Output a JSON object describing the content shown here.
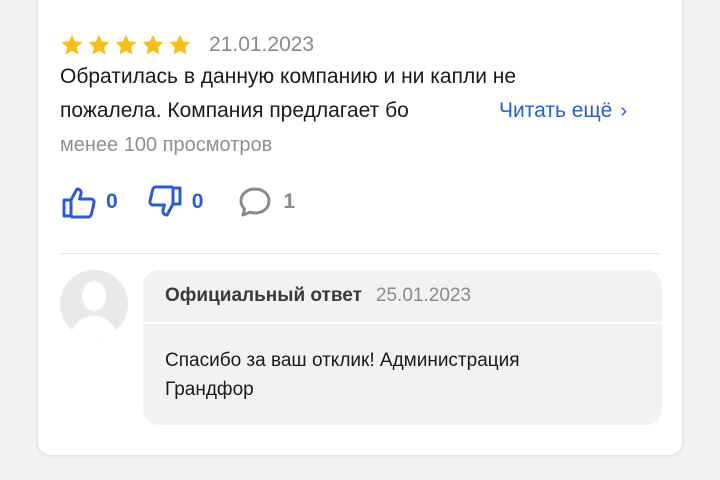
{
  "review": {
    "rating": 5,
    "rating_max": 5,
    "date": "21.01.2023",
    "text_line1": "Обратилась в данную компанию и ни капли не",
    "text_line2": "пожалела. Компания предлагает бо",
    "read_more": "Читать ещё",
    "views": "менее 100 просмотров",
    "likes": "0",
    "dislikes": "0",
    "comments": "1"
  },
  "reply": {
    "title": "Официальный ответ",
    "date": "25.01.2023",
    "text_line1": "Спасибо за ваш отклик! Администрация",
    "text_line2": "Грандфор"
  },
  "colors": {
    "star": "#F6BF1E",
    "link": "#2A5BD7",
    "muted": "#8A8A8A",
    "reply_bg": "#F2F2F2"
  },
  "icons": {
    "rating": "star-icon",
    "like": "thumbs-up-icon",
    "dislike": "thumbs-down-icon",
    "comment": "comment-bubble-icon",
    "read_more": "chevron-right-icon",
    "avatar": "user-silhouette-icon"
  }
}
